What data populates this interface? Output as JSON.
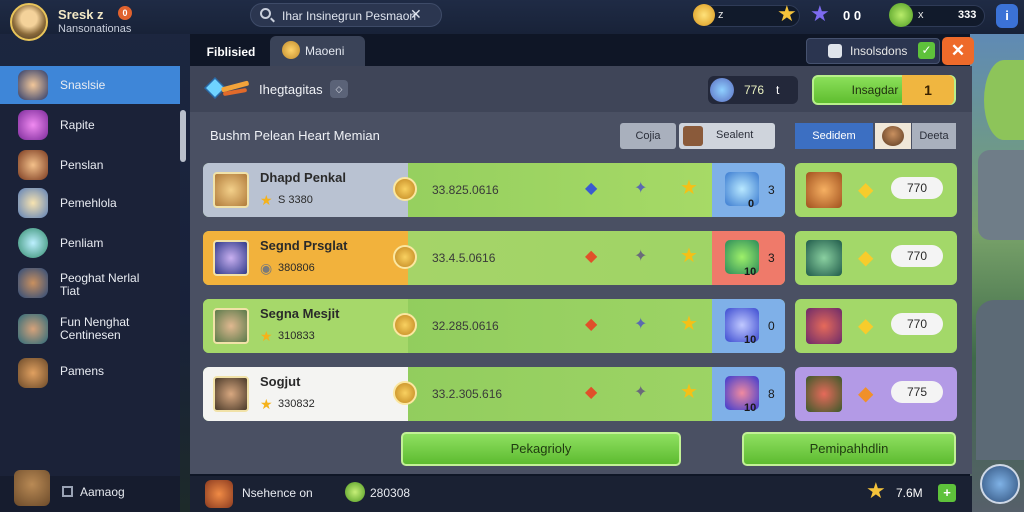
{
  "player": {
    "name": "Sresk z",
    "badge": "0",
    "subtitle": "Nansonationas"
  },
  "search": {
    "text": "Ihar Insinegrun Pesmaon",
    "btn": "✕"
  },
  "resources": {
    "r1": "z",
    "r3": "0 0",
    "r4_x": "x",
    "r4_val": "333"
  },
  "corner_btn": "i",
  "tabs": [
    {
      "label": "Fiblisied"
    },
    {
      "label": "Maoeni"
    }
  ],
  "notif": {
    "label": "Insolsdons",
    "check": "✓"
  },
  "close": "✕",
  "sidebar": {
    "items": [
      {
        "label": "Snaslsie"
      },
      {
        "label": "Rapite"
      },
      {
        "label": "Penslan"
      },
      {
        "label": "Pemehlola"
      },
      {
        "label": "Penliam"
      },
      {
        "label": "Peoghat Nerlal\nTiat"
      },
      {
        "label": "Fun Nenghat\nCentinesen"
      },
      {
        "label": "Pamens"
      }
    ],
    "bottom_label": "Aamaog"
  },
  "header": {
    "title": "Ihegtagitas",
    "box": "◇",
    "score": "776",
    "score_extra": "t",
    "cta_label": "Insagdar",
    "cta_num": "1"
  },
  "subtitle": "Bushm Pelean Heart Memian",
  "filters": [
    "Cojia",
    "Sealent",
    "Sedidem",
    "Deeta"
  ],
  "rows": [
    {
      "name": "Dhapd Penkal",
      "sub": "S 3380",
      "score": "33.825.0616",
      "hero_num": "0",
      "count": "3",
      "right_pill": "770"
    },
    {
      "name": "Segnd Prsglat",
      "sub": "380806",
      "score": "33.4.5.0616",
      "hero_num": "10",
      "count": "3",
      "right_pill": "770"
    },
    {
      "name": "Segna Mesjit",
      "sub": "310833",
      "score": "32.285.0616",
      "hero_num": "10",
      "count": "0",
      "right_pill": "770"
    },
    {
      "name": "Sogjut",
      "sub": "330832",
      "score": "33.2.305.616",
      "hero_num": "10",
      "count": "8",
      "right_pill": "775"
    }
  ],
  "actions": [
    "Pekagrioly",
    "Pemipahhdlin"
  ],
  "bottom": {
    "label": "Nsehence on",
    "val": "280308",
    "star_val": "7.6M",
    "plus": "+"
  },
  "colors": {
    "accent": "#3e86d8",
    "row_green": "#9ad36a",
    "row_orange": "#f3b640",
    "cta_green": "#6fcf3c",
    "close": "#ee6a2a"
  }
}
